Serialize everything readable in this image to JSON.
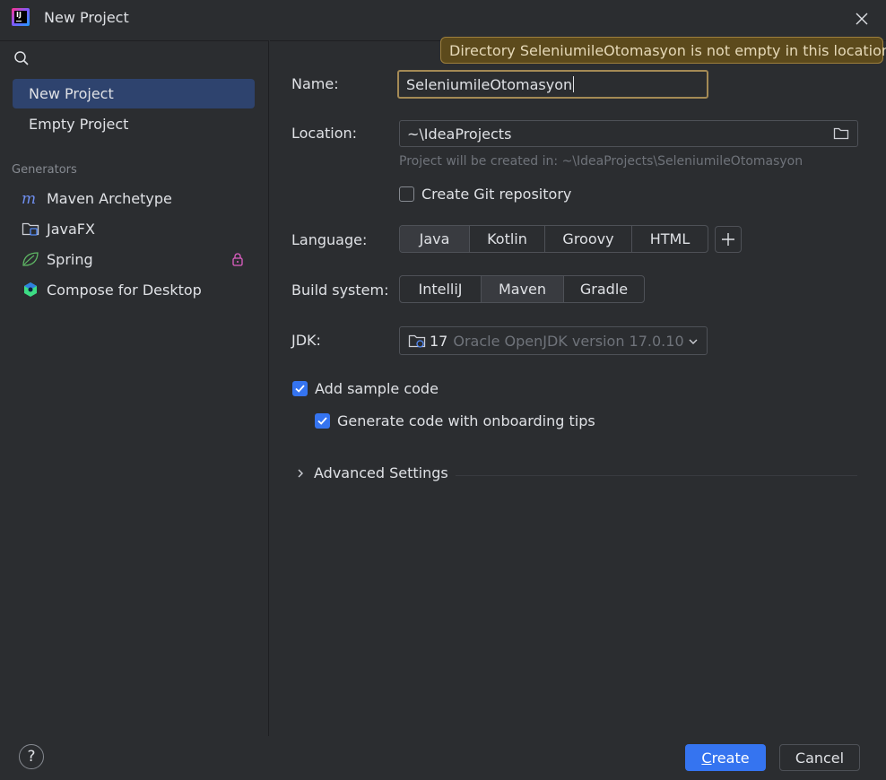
{
  "window": {
    "title": "New Project"
  },
  "sidebar": {
    "items": [
      {
        "label": "New Project",
        "selected": true
      },
      {
        "label": "Empty Project",
        "selected": false
      }
    ],
    "generators_heading": "Generators",
    "generators": [
      {
        "label": "Maven Archetype",
        "icon": "maven-icon"
      },
      {
        "label": "JavaFX",
        "icon": "javafx-folder-icon"
      },
      {
        "label": "Spring",
        "icon": "spring-leaf-icon",
        "locked": true
      },
      {
        "label": "Compose for Desktop",
        "icon": "compose-icon"
      }
    ]
  },
  "form": {
    "tooltip": "Directory SeleniumileOtomasyon is not empty in this location",
    "name_label": "Name:",
    "name_value": "SeleniumileOtomasyon",
    "location_label": "Location:",
    "location_value": "~\\IdeaProjects",
    "location_hint": "Project will be created in: ~\\IdeaProjects\\SeleniumileOtomasyon",
    "git_label": "Create Git repository",
    "git_checked": false,
    "language_label": "Language:",
    "languages": [
      "Java",
      "Kotlin",
      "Groovy",
      "HTML"
    ],
    "language_selected": "Java",
    "build_label": "Build system:",
    "build_systems": [
      "IntelliJ",
      "Maven",
      "Gradle"
    ],
    "build_selected": "Maven",
    "jdk_label": "JDK:",
    "jdk_version": "17",
    "jdk_description": "Oracle OpenJDK version 17.0.10",
    "sample_code_label": "Add sample code",
    "sample_code_checked": true,
    "onboarding_label": "Generate code with onboarding tips",
    "onboarding_checked": true,
    "advanced_label": "Advanced Settings"
  },
  "footer": {
    "help_label": "?",
    "create_mnemonic": "C",
    "create_rest": "reate",
    "cancel_label": "Cancel"
  },
  "colors": {
    "background": "#2b2d30",
    "selected": "#2e436e",
    "accent": "#3574f0",
    "warning_border": "#a48a55",
    "tooltip_bg": "#5c4a1c"
  }
}
